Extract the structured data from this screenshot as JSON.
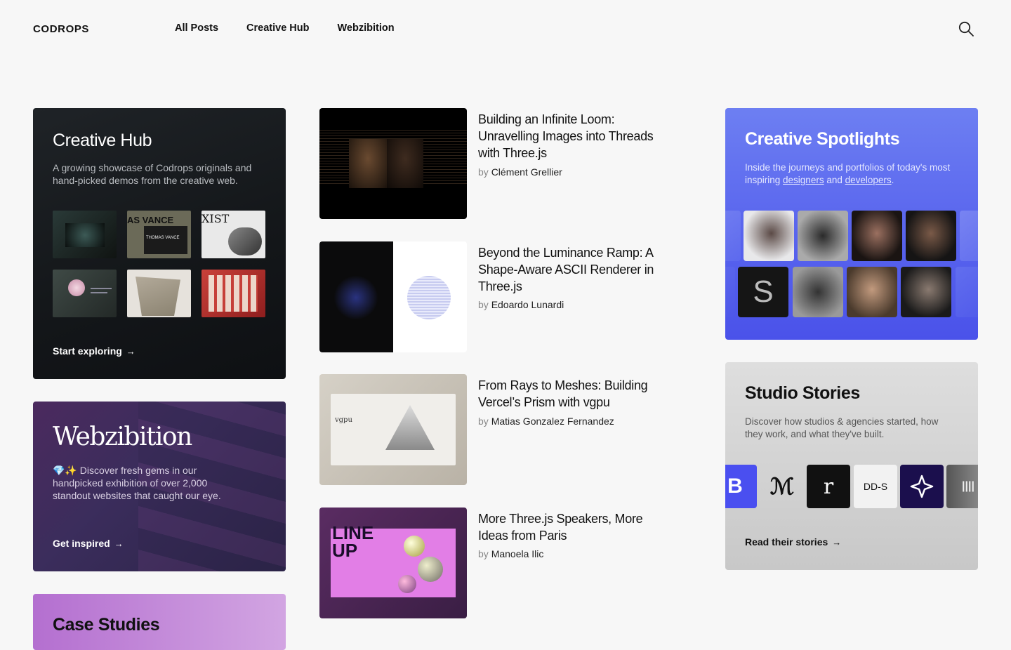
{
  "header": {
    "logo": "CODROPS",
    "nav": [
      "All Posts",
      "Creative Hub",
      "Webzibition"
    ]
  },
  "hub": {
    "title": "Creative Hub",
    "description": "A growing showcase of Codrops originals and hand-picked demos from the creative web.",
    "cta": "Start exploring"
  },
  "webzibition": {
    "title": "Webzibition",
    "description": "💎✨ Discover fresh gems in our handpicked exhibition of over 2,000 standout websites that caught our eye.",
    "cta": "Get inspired"
  },
  "case_studies": {
    "title": "Case Studies"
  },
  "articles": [
    {
      "title": "Building an Infinite Loom: Unravelling Images into Threads with Three.js",
      "by": "by",
      "author": "Clément Grellier"
    },
    {
      "title": "Beyond the Luminance Ramp: A Shape-Aware ASCII Renderer in Three.js",
      "by": "by",
      "author": "Edoardo Lunardi"
    },
    {
      "title": "From Rays to Meshes: Building Vercel’s Prism with vgpu",
      "by": "by",
      "author": "Matias Gonzalez Fernandez"
    },
    {
      "title": "More Three.js Speakers, More Ideas from Paris",
      "by": "by",
      "author": "Manoela Ilic"
    }
  ],
  "spotlights": {
    "title": "Creative Spotlights",
    "desc_before": "Inside the journeys and portfolios of today's most inspiring ",
    "link_designers": "designers",
    "desc_and": " and ",
    "link_developers": "developers",
    "desc_end": "."
  },
  "studio": {
    "title": "Studio Stories",
    "description": "Discover how studios & agencies started, how they work, and what they've built.",
    "cta": "Read their stories",
    "logo_texts": [
      "r",
      "DD-S",
      "ℳ"
    ]
  },
  "thumb_texts": [
    "THOMAS VANCE",
    "AS VANCE",
    "XIST"
  ],
  "article_image_texts": [
    "vgpu",
    "LINE UP"
  ],
  "icons": {
    "search": "search-icon",
    "arrow": "arrow-right-icon"
  }
}
